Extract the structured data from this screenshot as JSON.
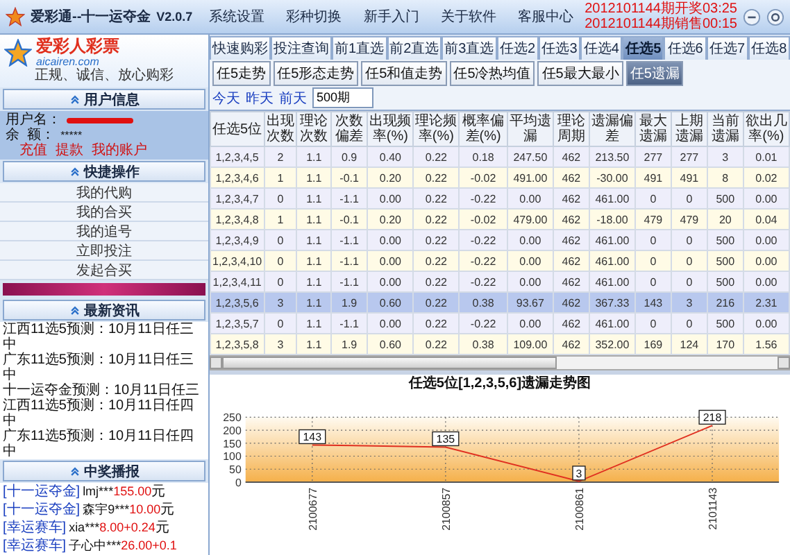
{
  "app": {
    "title": "爱彩通--十一运夺金",
    "version": "V2.0.7"
  },
  "menu": [
    "系统设置",
    "彩种切换",
    "新手入门",
    "关于软件",
    "客服中心"
  ],
  "draw_notices": [
    "2012101144期开奖03:25",
    "2012101144期销售00:15"
  ],
  "logo": {
    "name": "爱彩人彩票",
    "domain": "aicairen.com",
    "slogan": "正规、诚信、放心购彩"
  },
  "user_panel": {
    "title": "用户信息",
    "username_label": "用户名：",
    "balance_label": "余  额：",
    "balance": "*****",
    "links": [
      "充值",
      "提款",
      "我的账户"
    ]
  },
  "quick_actions": {
    "title": "快捷操作",
    "items": [
      "我的代购",
      "我的合买",
      "我的追号",
      "立即投注",
      "发起合买"
    ]
  },
  "news": {
    "title": "最新资讯",
    "items": [
      "江西11选5预测：10月11日任三中",
      "广东11选5预测：10月11日任三中",
      "十一运夺金预测：10月11日任三",
      "江西11选5预测：10月11日任四中",
      "广东11选5预测：10月11日任四中"
    ]
  },
  "prizes": {
    "title": "中奖播报",
    "items": [
      {
        "game": "[十一运夺金]",
        "user": "lmj***",
        "amount": "155.00",
        "unit": "元"
      },
      {
        "game": "[十一运夺金]",
        "user": "森宇9***",
        "amount": "10.00",
        "unit": "元"
      },
      {
        "game": "[幸运赛车]",
        "user": "xia***",
        "amount": "8.00+0.24",
        "unit": "元"
      },
      {
        "game": "[幸运赛车]",
        "user": "子心中***",
        "amount": "26.00+0.1"
      }
    ]
  },
  "tabs": [
    {
      "label": "快速购彩",
      "selected": false
    },
    {
      "label": "投注查询",
      "selected": false
    },
    {
      "label": "前1直选",
      "selected": false
    },
    {
      "label": "前2直选",
      "selected": false
    },
    {
      "label": "前3直选",
      "selected": false
    },
    {
      "label": "任选2",
      "selected": false
    },
    {
      "label": "任选3",
      "selected": false
    },
    {
      "label": "任选4",
      "selected": false
    },
    {
      "label": "任选5",
      "selected": true
    },
    {
      "label": "任选6",
      "selected": false
    },
    {
      "label": "任选7",
      "selected": false
    },
    {
      "label": "任选8",
      "selected": false
    }
  ],
  "subtabs": [
    {
      "label": "任5走势",
      "selected": false
    },
    {
      "label": "任5形态走势",
      "selected": false
    },
    {
      "label": "任5和值走势",
      "selected": false
    },
    {
      "label": "任5冷热均值",
      "selected": false
    },
    {
      "label": "任5最大最小",
      "selected": false
    },
    {
      "label": "任5遗漏",
      "selected": true
    }
  ],
  "date_links": [
    "今天",
    "昨天",
    "前天"
  ],
  "period_input": {
    "value": "500期"
  },
  "table": {
    "columns": [
      "任选5位",
      "出现次数",
      "理论次数",
      "次数偏差",
      "出现频率(%)",
      "理论频率(%)",
      "概率偏差(%)",
      "平均遗漏",
      "理论周期",
      "遗漏偏差",
      "最大遗漏",
      "上期遗漏",
      "当前遗漏",
      "欲出几率(%)"
    ],
    "rows": [
      {
        "selected": false,
        "cells": [
          "1,2,3,4,5",
          "2",
          "1.1",
          "0.9",
          "0.40",
          "0.22",
          "0.18",
          "247.50",
          "462",
          "213.50",
          "277",
          "277",
          "3",
          "0.01"
        ]
      },
      {
        "selected": false,
        "cells": [
          "1,2,3,4,6",
          "1",
          "1.1",
          "-0.1",
          "0.20",
          "0.22",
          "-0.02",
          "491.00",
          "462",
          "-30.00",
          "491",
          "491",
          "8",
          "0.02"
        ]
      },
      {
        "selected": false,
        "cells": [
          "1,2,3,4,7",
          "0",
          "1.1",
          "-1.1",
          "0.00",
          "0.22",
          "-0.22",
          "0.00",
          "462",
          "461.00",
          "0",
          "0",
          "500",
          "0.00"
        ]
      },
      {
        "selected": false,
        "cells": [
          "1,2,3,4,8",
          "1",
          "1.1",
          "-0.1",
          "0.20",
          "0.22",
          "-0.02",
          "479.00",
          "462",
          "-18.00",
          "479",
          "479",
          "20",
          "0.04"
        ]
      },
      {
        "selected": false,
        "cells": [
          "1,2,3,4,9",
          "0",
          "1.1",
          "-1.1",
          "0.00",
          "0.22",
          "-0.22",
          "0.00",
          "462",
          "461.00",
          "0",
          "0",
          "500",
          "0.00"
        ]
      },
      {
        "selected": false,
        "cells": [
          "1,2,3,4,10",
          "0",
          "1.1",
          "-1.1",
          "0.00",
          "0.22",
          "-0.22",
          "0.00",
          "462",
          "461.00",
          "0",
          "0",
          "500",
          "0.00"
        ]
      },
      {
        "selected": false,
        "cells": [
          "1,2,3,4,11",
          "0",
          "1.1",
          "-1.1",
          "0.00",
          "0.22",
          "-0.22",
          "0.00",
          "462",
          "461.00",
          "0",
          "0",
          "500",
          "0.00"
        ]
      },
      {
        "selected": true,
        "cells": [
          "1,2,3,5,6",
          "3",
          "1.1",
          "1.9",
          "0.60",
          "0.22",
          "0.38",
          "93.67",
          "462",
          "367.33",
          "143",
          "3",
          "216",
          "2.31"
        ]
      },
      {
        "selected": false,
        "cells": [
          "1,2,3,5,7",
          "0",
          "1.1",
          "-1.1",
          "0.00",
          "0.22",
          "-0.22",
          "0.00",
          "462",
          "461.00",
          "0",
          "0",
          "500",
          "0.00"
        ]
      },
      {
        "selected": false,
        "cells": [
          "1,2,3,5,8",
          "3",
          "1.1",
          "1.9",
          "0.60",
          "0.22",
          "0.38",
          "109.00",
          "462",
          "352.00",
          "169",
          "124",
          "170",
          "1.56"
        ]
      }
    ]
  },
  "chart_data": {
    "type": "line",
    "title": "任选5位[1,2,3,5,6]遗漏走势图",
    "categories": [
      "2100677",
      "2100857",
      "2100861",
      "2101143"
    ],
    "series": [
      {
        "color": "#e03020",
        "values": [
          143,
          135,
          3,
          218
        ]
      }
    ],
    "grid": true,
    "ylim": [
      0,
      250
    ],
    "yticks": [
      0,
      50,
      100,
      150,
      200,
      250
    ],
    "data_labels": true
  }
}
